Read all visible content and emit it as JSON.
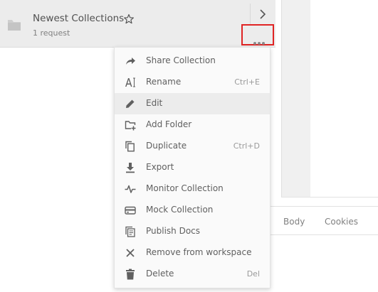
{
  "collection": {
    "title": "Newest Collections",
    "subtitle": "1 request"
  },
  "icons": {
    "folder": "folder-icon",
    "star": "star-icon",
    "chevron": "chevron-right-icon",
    "more": "more-horizontal-icon"
  },
  "colors": {
    "highlight_border": "#e02424",
    "menu_bg": "#fafafa",
    "active_row": "#ececec"
  },
  "menu": {
    "items": [
      {
        "label": "Share Collection",
        "shortcut": "",
        "icon": "share-icon"
      },
      {
        "label": "Rename",
        "shortcut": "Ctrl+E",
        "icon": "rename-icon"
      },
      {
        "label": "Edit",
        "shortcut": "",
        "icon": "pencil-icon",
        "active": true
      },
      {
        "label": "Add Folder",
        "shortcut": "",
        "icon": "add-folder-icon"
      },
      {
        "label": "Duplicate",
        "shortcut": "Ctrl+D",
        "icon": "duplicate-icon"
      },
      {
        "label": "Export",
        "shortcut": "",
        "icon": "export-icon"
      },
      {
        "label": "Monitor Collection",
        "shortcut": "",
        "icon": "monitor-icon"
      },
      {
        "label": "Mock Collection",
        "shortcut": "",
        "icon": "mock-icon"
      },
      {
        "label": "Publish Docs",
        "shortcut": "",
        "icon": "docs-icon"
      },
      {
        "label": "Remove from workspace",
        "shortcut": "",
        "icon": "close-icon"
      },
      {
        "label": "Delete",
        "shortcut": "Del",
        "icon": "trash-icon"
      }
    ]
  },
  "right_panel": {
    "tabs": [
      "Body",
      "Cookies"
    ]
  }
}
